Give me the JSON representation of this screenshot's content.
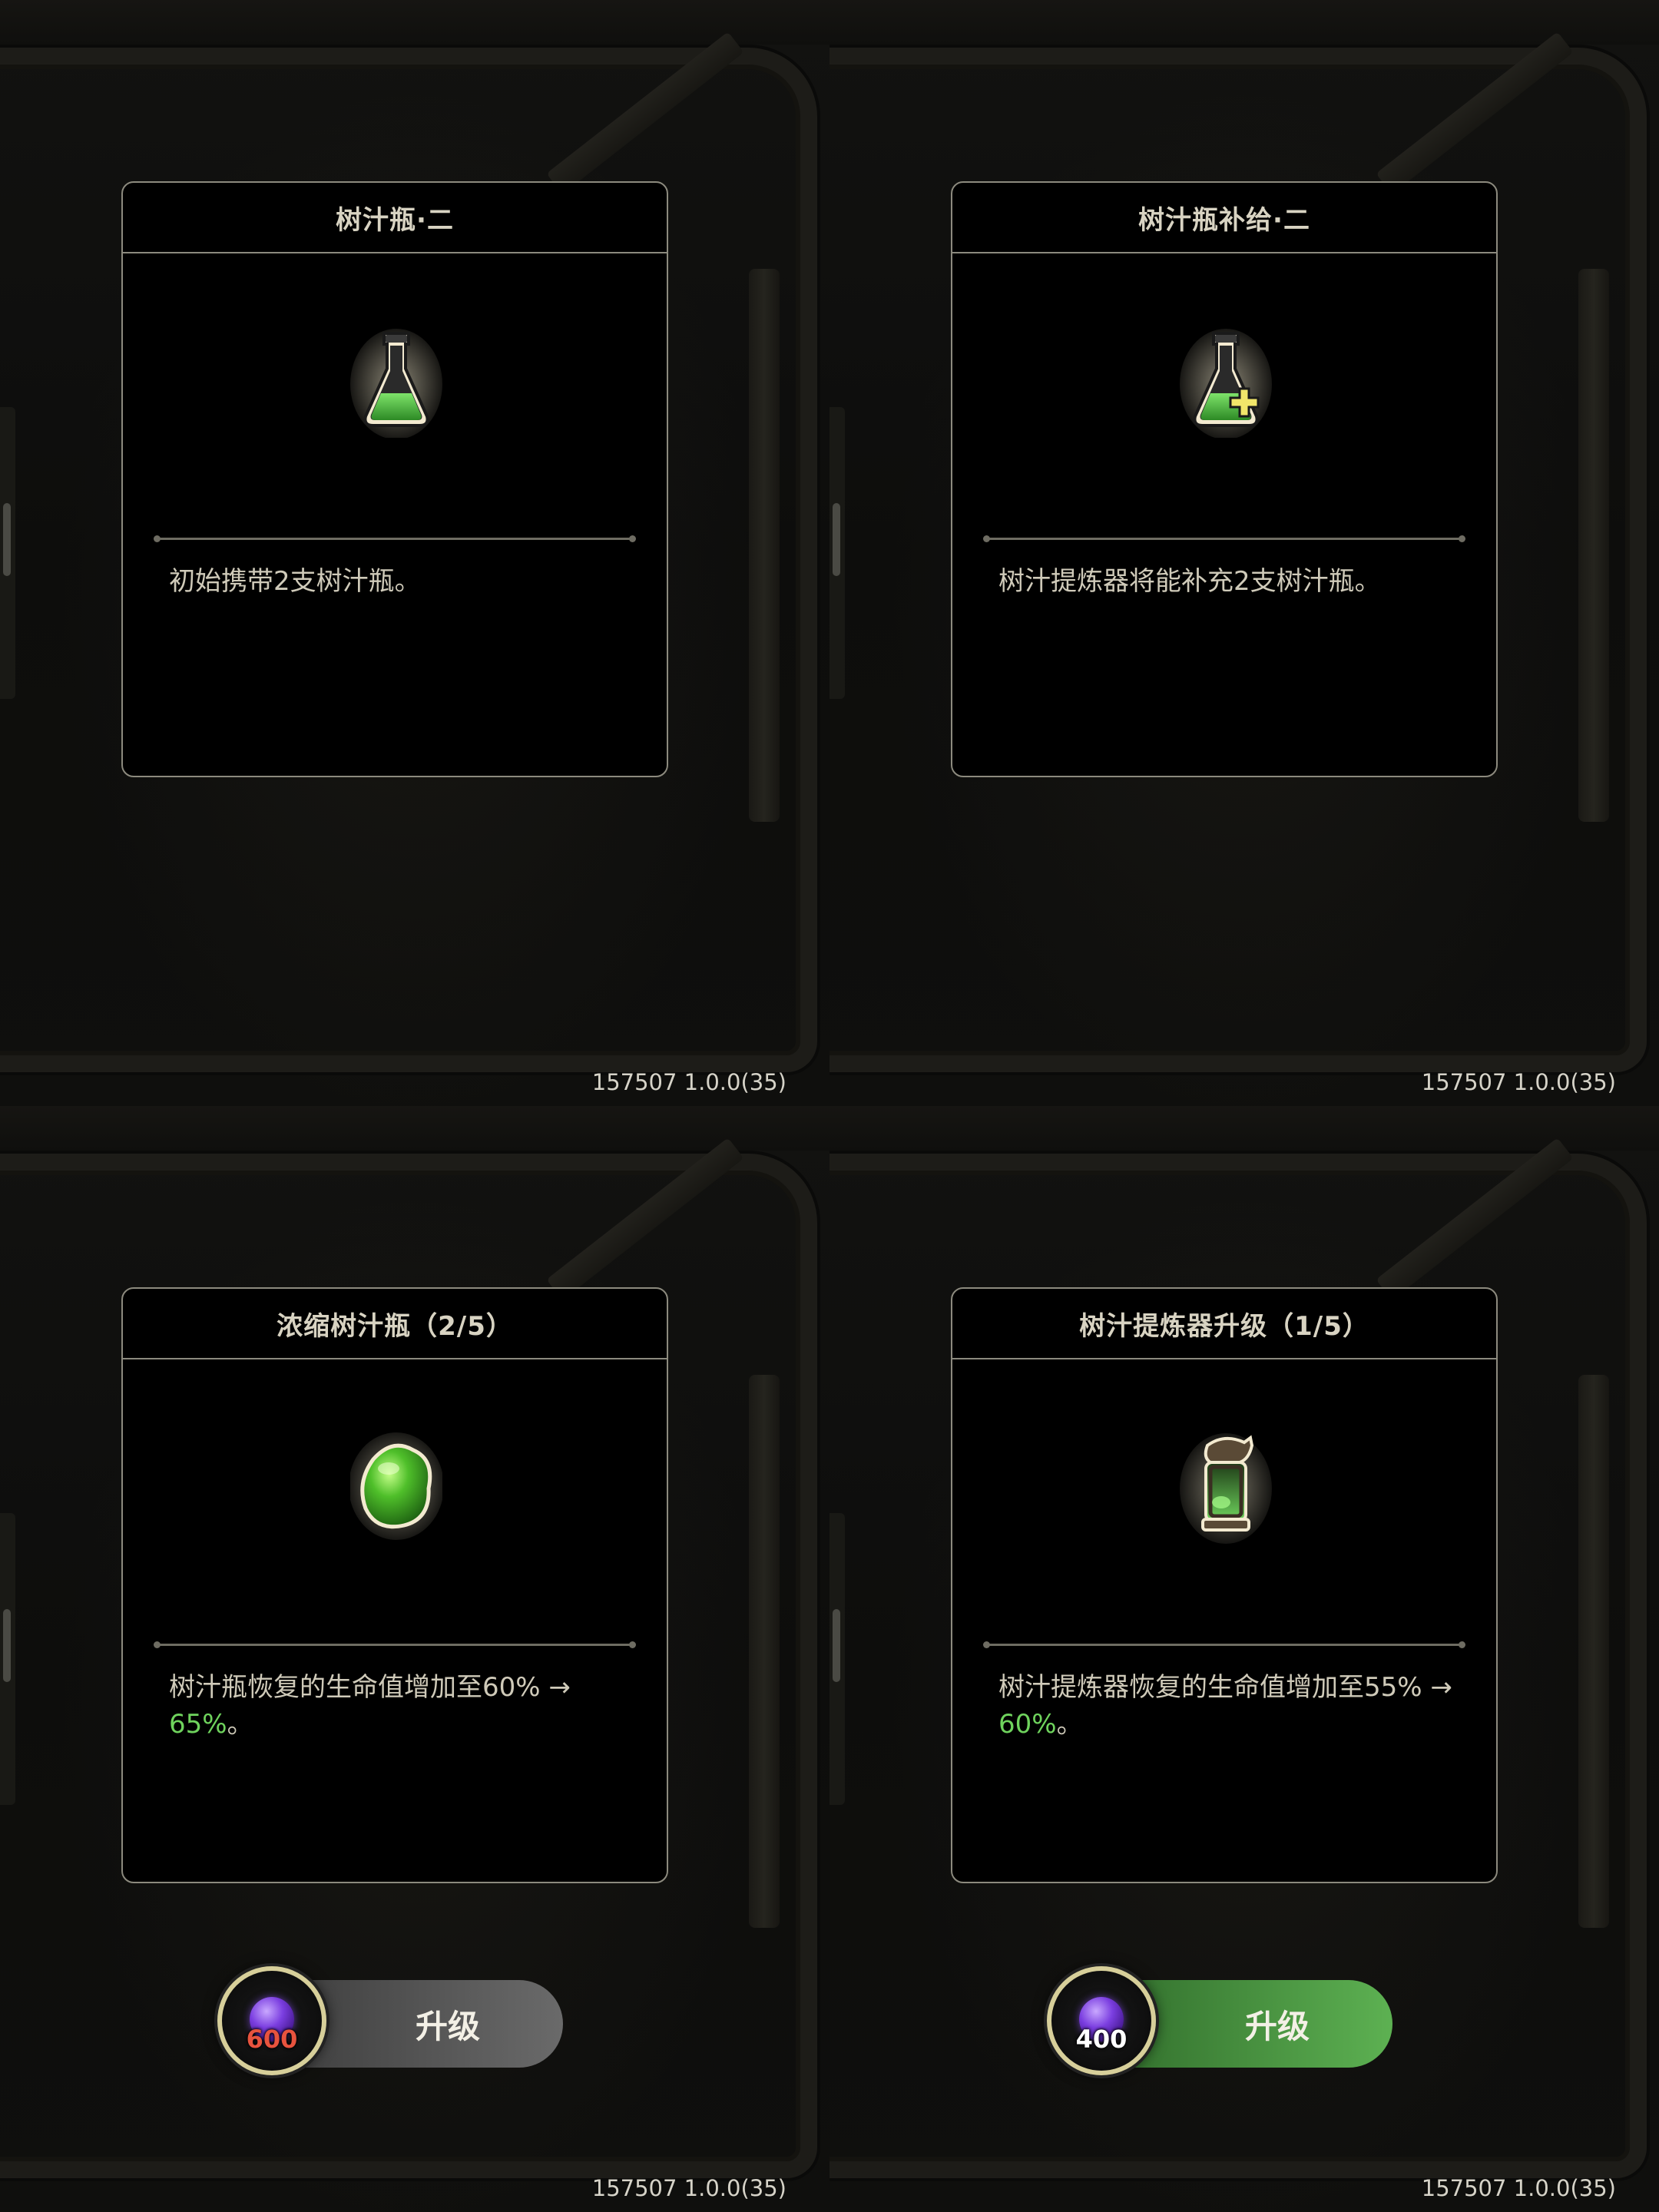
{
  "version": "157507 1.0.0(35)",
  "panels": [
    {
      "title": "树汁瓶·二",
      "icon": "sap-flask-icon",
      "desc_main": "初始携带2支树汁瓶。",
      "desc_highlight": ""
    },
    {
      "title": "树汁瓶补给·二",
      "icon": "sap-flask-plus-icon",
      "desc_main": "树汁提炼器将能补充2支树汁瓶。",
      "desc_highlight": ""
    },
    {
      "title": "浓缩树汁瓶（2/5）",
      "icon": "green-sap-blob-icon",
      "desc_main": "树汁瓶恢复的生命值增加至60% → ",
      "desc_highlight": "65%",
      "desc_tail": "。",
      "upgrade": {
        "label": "升级",
        "cost": "600",
        "affordable": false
      }
    },
    {
      "title": "树汁提炼器升级（1/5）",
      "icon": "sap-refiner-lantern-icon",
      "desc_main": "树汁提炼器恢复的生命值增加至55% → ",
      "desc_highlight": "60%",
      "desc_tail": "。",
      "upgrade": {
        "label": "升级",
        "cost": "400",
        "affordable": true
      }
    }
  ],
  "colors": {
    "highlight": "#6fd35d",
    "button_gray": "#6a6a6a",
    "button_green": "#5db152",
    "cost_unaffordable": "#e8533e",
    "currency_orb": "#7b3ee0"
  }
}
